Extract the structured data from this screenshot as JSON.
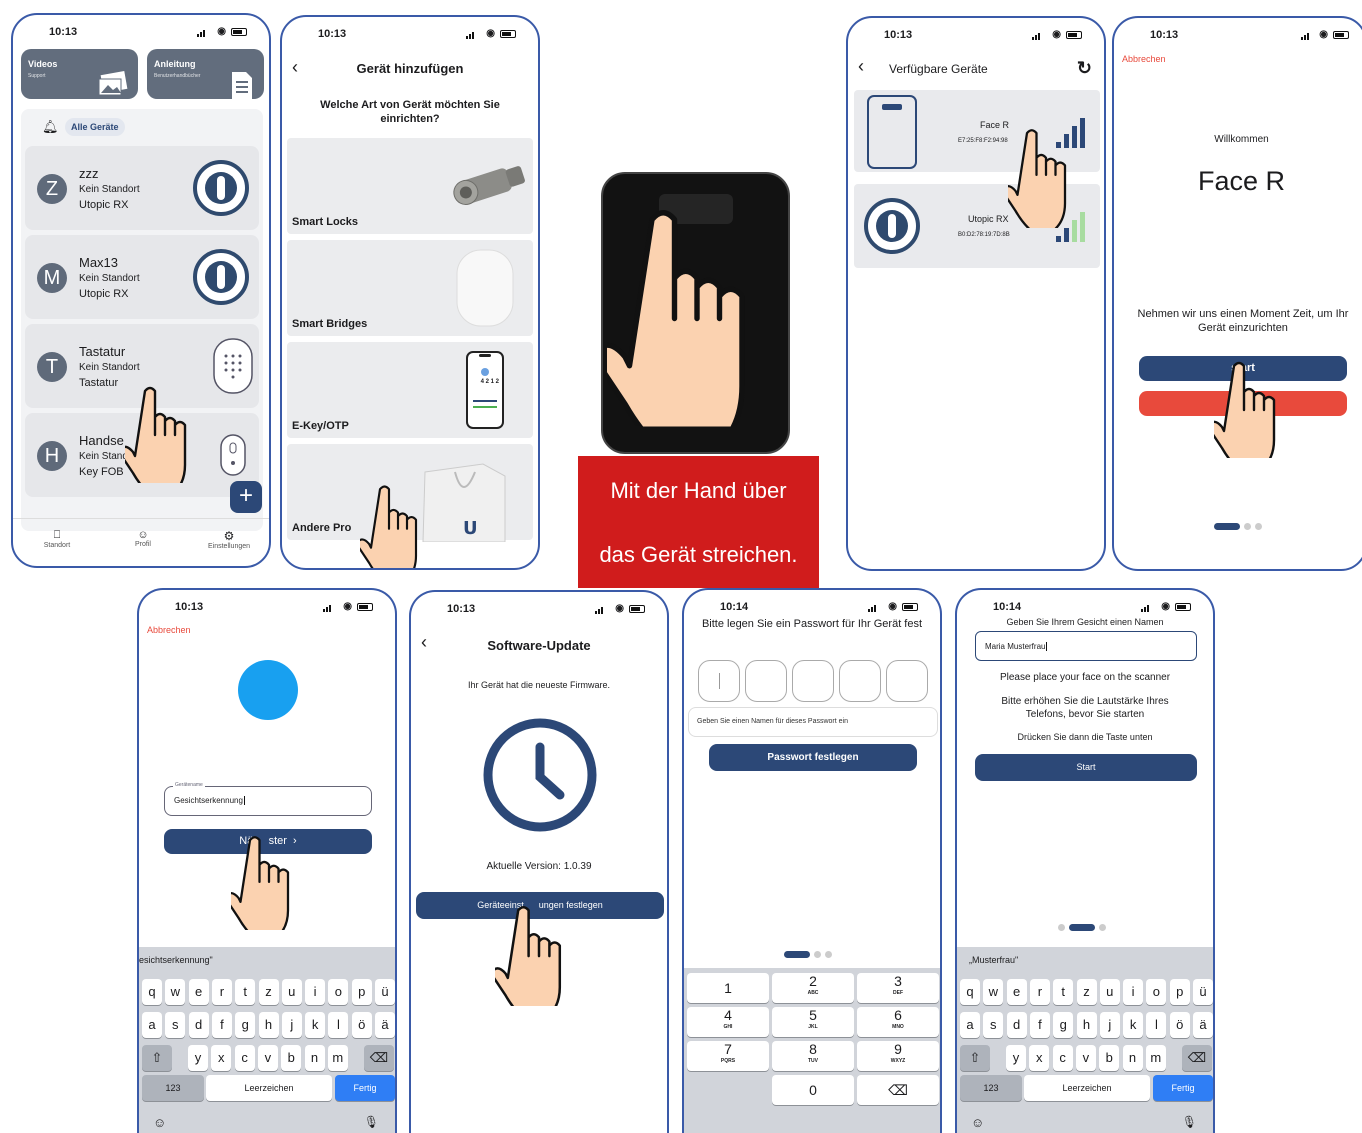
{
  "status_time": "10:13",
  "status_time_b": "10:14",
  "screen1": {
    "tile_videos": {
      "title": "Videos",
      "sub": "Support"
    },
    "tile_guide": {
      "title": "Anleitung",
      "sub": "Benutzerhandbücher"
    },
    "filter": "Alle Geräte",
    "devices": [
      {
        "initial": "Z",
        "name": "zzz",
        "location": "Kein Standort",
        "type": "Utopic RX"
      },
      {
        "initial": "M",
        "name": "Max13",
        "location": "Kein Standort",
        "type": "Utopic RX"
      },
      {
        "initial": "T",
        "name": "Tastatur",
        "location": "Kein Standort",
        "type": "Tastatur"
      },
      {
        "initial": "H",
        "name": "Handse",
        "location": "Kein Standor",
        "type": "Key FOB"
      }
    ],
    "tabs": [
      "Standort",
      "Profil",
      "Einstellungen"
    ],
    "add": "+"
  },
  "screen2": {
    "title": "Gerät hinzufügen",
    "question": "Welche Art von Gerät möchten Sie einrichten?",
    "categories": [
      "Smart Locks",
      "Smart Bridges",
      "E-Key/OTP",
      "Andere Pro"
    ],
    "otp_digits": "4 2 1 2"
  },
  "center": {
    "line1": "Mit der Hand über",
    "line2": "das Gerät streichen."
  },
  "screen3": {
    "title": "Verfügbare Geräte",
    "devices": [
      {
        "name": "Face R",
        "mac": "E7:25:F8:F2:94:98"
      },
      {
        "name": "Utopic RX",
        "mac": "B0:D2:78:19:7D:8B"
      }
    ]
  },
  "screen4": {
    "cancel": "Abbrechen",
    "welcome": "Willkommen",
    "device": "Face R",
    "text": "Nehmen wir uns einen Moment Zeit, um Ihr Gerät einzurichten",
    "start": "start",
    "second_btn": "a"
  },
  "screen5": {
    "cancel": "Abbrechen",
    "field_label": "Gerätename",
    "field_value": "Gesichtserkennung",
    "next": "Nä     ster  ›",
    "suggestion": "esichtserkennung\""
  },
  "screen6": {
    "title": "Software-Update",
    "info": "Ihr Gerät hat die neueste Firmware.",
    "version": "Aktuelle Version: 1.0.39",
    "button": "Geräteeinst      ungen festlegen"
  },
  "screen7": {
    "title": "Bitte legen Sie ein Passwort für Ihr Gerät fest",
    "name_placeholder": "Geben Sie einen Namen für dieses Passwort ein",
    "button": "Passwort festlegen",
    "numpad": [
      {
        "d": "1",
        "l": ""
      },
      {
        "d": "2",
        "l": "ABC"
      },
      {
        "d": "3",
        "l": "DEF"
      },
      {
        "d": "4",
        "l": "GHI"
      },
      {
        "d": "5",
        "l": "JKL"
      },
      {
        "d": "6",
        "l": "MNO"
      },
      {
        "d": "7",
        "l": "PQRS"
      },
      {
        "d": "8",
        "l": "TUV"
      },
      {
        "d": "9",
        "l": "WXYZ"
      },
      {
        "d": "",
        "l": ""
      },
      {
        "d": "0",
        "l": ""
      },
      {
        "d": "⌫",
        "l": ""
      }
    ]
  },
  "screen8": {
    "title": "Geben Sie Ihrem Gesicht einen Namen",
    "field_value": "Maria Musterfrau",
    "t1": "Please place your face on the scanner",
    "t2": "Bitte erhöhen Sie die Lautstärke Ihres Telefons, bevor Sie starten",
    "t3": "Drücken Sie dann die Taste unten",
    "start": "Start",
    "suggestion": "„Musterfrau\""
  },
  "keyboard": {
    "row1": [
      "q",
      "w",
      "e",
      "r",
      "t",
      "z",
      "u",
      "i",
      "o",
      "p",
      "ü"
    ],
    "row2": [
      "a",
      "s",
      "d",
      "f",
      "g",
      "h",
      "j",
      "k",
      "l",
      "ö",
      "ä"
    ],
    "row3": [
      "y",
      "x",
      "c",
      "v",
      "b",
      "n",
      "m"
    ],
    "shift": "⇧",
    "backspace": "⌫",
    "num": "123",
    "space": "Leerzeichen",
    "done": "Fertig"
  },
  "colors": {
    "primary": "#2c4877",
    "danger": "#e84a3c",
    "accent_red": "#d01c1c",
    "light_blue": "#18a0f0"
  }
}
